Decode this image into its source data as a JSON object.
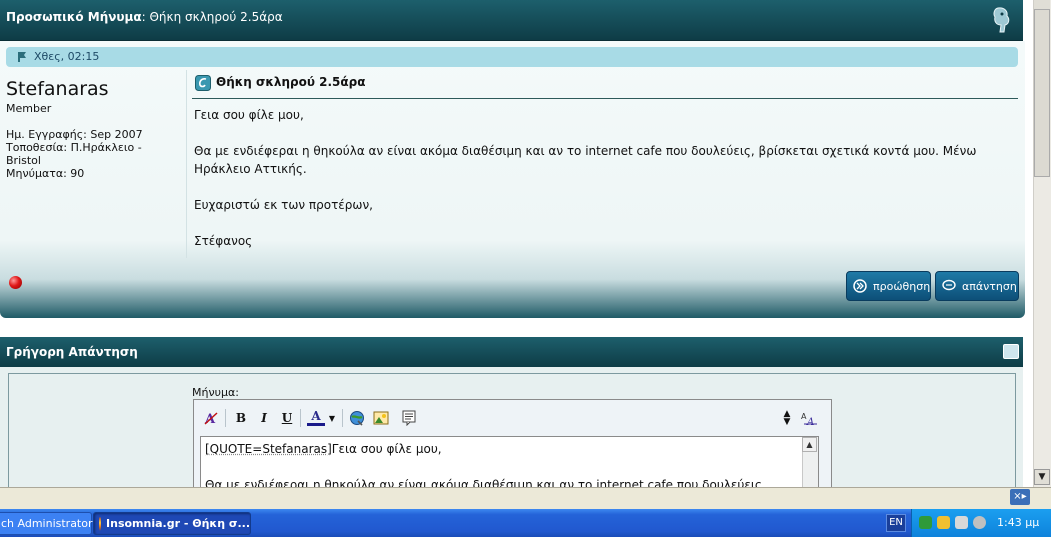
{
  "header": {
    "label": "Προσωπικό Μήνυμα",
    "subject": "Θήκη σκληρού 2.5άρα"
  },
  "post": {
    "date": "Χθες, 02:15",
    "username": "Stefanaras",
    "usertitle": "Member",
    "info": {
      "joined": "Ημ. Εγγραφής: Sep 2007",
      "location": "Τοποθεσία: Π.Ηράκλειο - Bristol",
      "posts": "Μηνύματα: 90"
    },
    "title": "Θήκη σκληρού 2.5άρα",
    "body": [
      "Γεια σου φίλε μου,",
      "Θα με ενδιέφεραι η θηκούλα αν είναι ακόμα διαθέσιμη και αν το internet cafe που δουλεύεις, βρίσκεται σχετικά κοντά μου. Μένω Ηράκλειο Αττικής.",
      "Ευχαριστώ εκ των προτέρων,",
      "Στέφανος"
    ],
    "buttons": {
      "forward": "προώθηση",
      "reply": "απάντηση"
    }
  },
  "quick_reply": {
    "title": "Γρήγορη Απάντηση",
    "message_label": "Μήνυμα:",
    "editor_line1_quote": "[QUOTE=Stefanaras]",
    "editor_line1_text": "Γεια σου φίλε μου,",
    "editor_line2": "Θα με ενδιέφεραι η θηκούλα αν είναι ακόμα διαθέσιμη και αν το internet cafe που δουλεύεις,",
    "toolbar": {
      "bold": "B",
      "italic": "I",
      "underline": "U",
      "color": "A"
    }
  },
  "taskbar": {
    "admin_item": "ch Administrator",
    "active_item": "Insomnia.gr - Θήκη σ...",
    "language": "EN",
    "clock": "1:43 μμ"
  },
  "colors": {
    "header_bg": "#1d5f6c",
    "date_strip": "#a8dbe6",
    "button_bg": "#1f7aa6",
    "taskbar_bg": "#2158cf"
  }
}
